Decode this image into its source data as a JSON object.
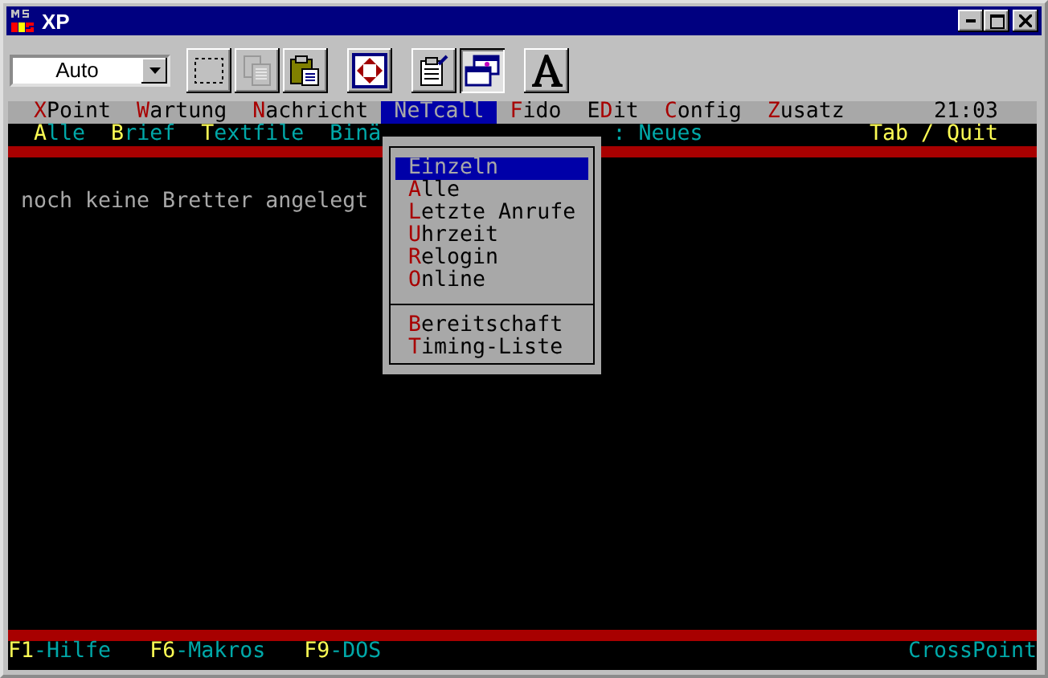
{
  "window": {
    "title": "XP"
  },
  "toolbar": {
    "font_size": "Auto",
    "tools": [
      {
        "kind": "select",
        "pressed": false,
        "disabled": false
      },
      {
        "kind": "copy",
        "pressed": false,
        "disabled": true
      },
      {
        "kind": "paste",
        "pressed": false,
        "disabled": false
      },
      {
        "kind": "fullscreen",
        "pressed": false,
        "disabled": false
      },
      {
        "kind": "properties",
        "pressed": false,
        "disabled": false
      },
      {
        "kind": "background",
        "pressed": true,
        "disabled": false
      },
      {
        "kind": "font",
        "pressed": false,
        "disabled": false
      }
    ]
  },
  "menu_bar": {
    "items": [
      {
        "key": "X",
        "post": "Point",
        "selected": false
      },
      {
        "key": "W",
        "post": "artung",
        "selected": false
      },
      {
        "key": "N",
        "post": "achricht",
        "selected": false
      },
      {
        "key": "N",
        "post": "eTcall",
        "selected": true
      },
      {
        "key": "F",
        "post": "ido",
        "selected": false
      },
      {
        "pre": "E",
        "key": "D",
        "post": "it",
        "selected": false
      },
      {
        "key": "C",
        "post": "onfig",
        "selected": false
      },
      {
        "key": "Z",
        "post": "usatz",
        "selected": false
      }
    ],
    "clock": "21:03"
  },
  "key_line": {
    "items": [
      {
        "key": "A",
        "post": "lle"
      },
      {
        "key": "B",
        "post": "rief"
      },
      {
        "key": "T",
        "post": "extfile"
      },
      {
        "post": "Binä"
      }
    ],
    "partial": ": Neues",
    "right": "Tab / Quit"
  },
  "message": "noch keine Bretter angelegt",
  "dropdown": {
    "groups": [
      [
        {
          "key": "E",
          "post": "inzeln",
          "selected": true
        },
        {
          "key": "A",
          "post": "lle",
          "selected": false
        },
        {
          "key": "L",
          "post": "etzte Anrufe",
          "selected": false
        },
        {
          "key": "U",
          "post": "hrzeit",
          "selected": false
        },
        {
          "key": "R",
          "post": "elogin",
          "selected": false
        },
        {
          "key": "O",
          "post": "nline",
          "selected": false
        }
      ],
      [
        {
          "key": "B",
          "post": "ereitschaft",
          "selected": false
        },
        {
          "key": "T",
          "post": "iming-Liste",
          "selected": false
        }
      ]
    ]
  },
  "status_bar": {
    "keys": [
      {
        "key": "F1",
        "label": "-Hilfe"
      },
      {
        "key": "F6",
        "label": "-Makros"
      },
      {
        "key": "F9",
        "label": "-DOS"
      }
    ],
    "app": "CrossPoint"
  }
}
